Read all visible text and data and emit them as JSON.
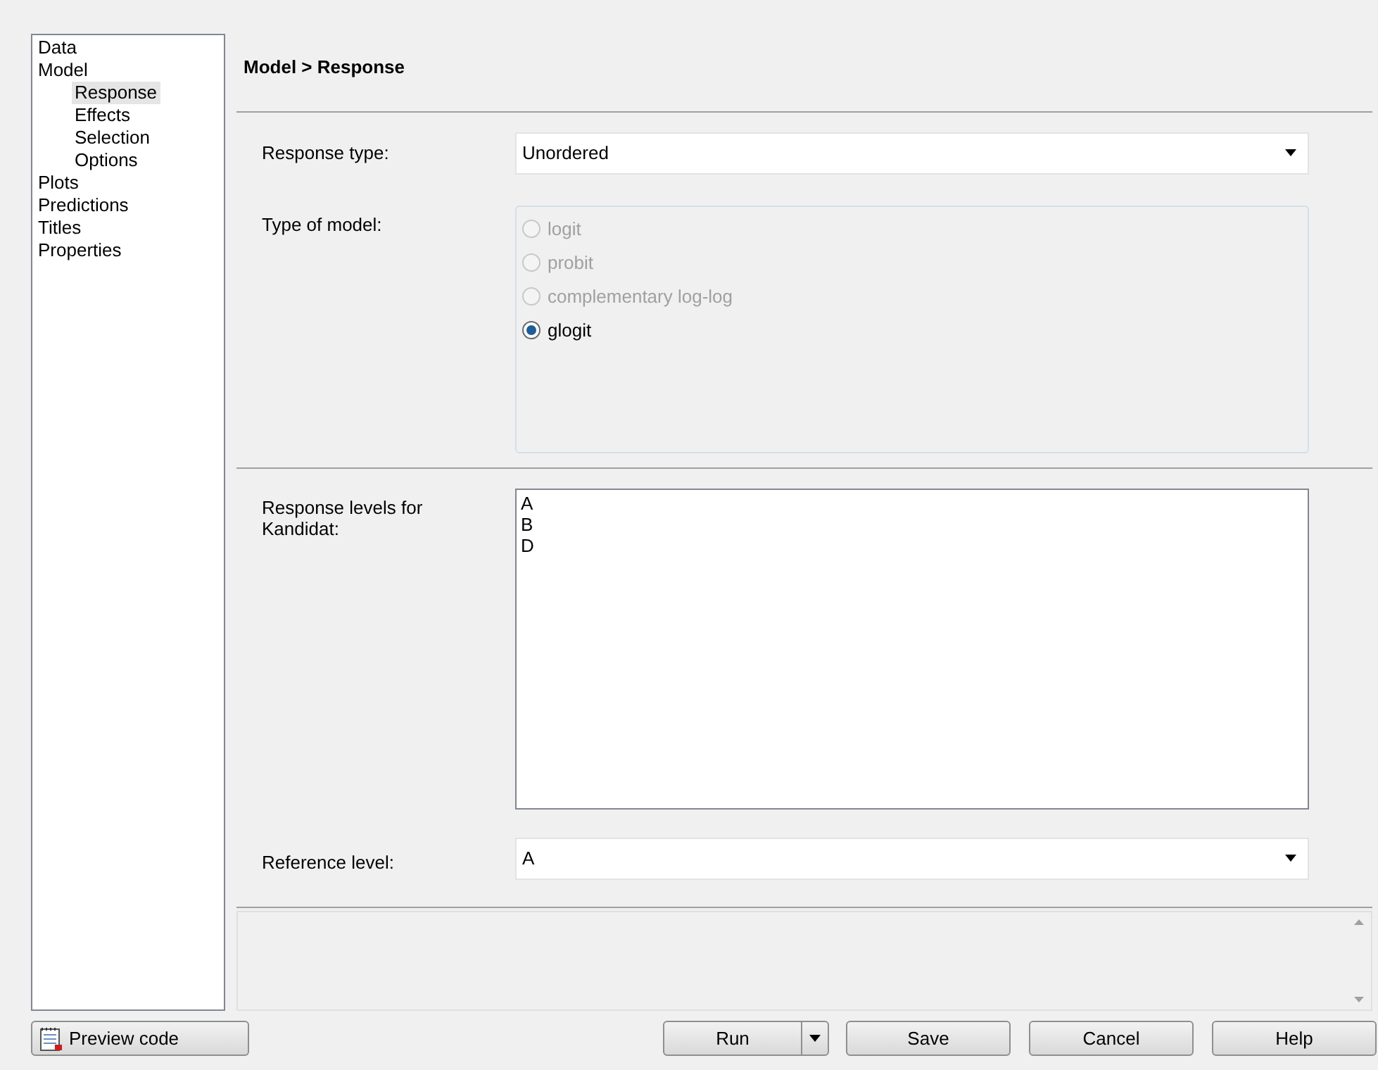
{
  "sidebar": {
    "items": [
      {
        "label": "Data",
        "selected": false
      },
      {
        "label": "Model",
        "selected": false,
        "children": [
          {
            "label": "Response",
            "selected": true
          },
          {
            "label": "Effects",
            "selected": false
          },
          {
            "label": "Selection",
            "selected": false
          },
          {
            "label": "Options",
            "selected": false
          }
        ]
      },
      {
        "label": "Plots",
        "selected": false
      },
      {
        "label": "Predictions",
        "selected": false
      },
      {
        "label": "Titles",
        "selected": false
      },
      {
        "label": "Properties",
        "selected": false
      }
    ]
  },
  "header": "Model > Response",
  "response_type": {
    "label": "Response type:",
    "value": "Unordered"
  },
  "model_type": {
    "label": "Type of model:",
    "options": [
      {
        "label": "logit",
        "selected": false,
        "disabled": true
      },
      {
        "label": "probit",
        "selected": false,
        "disabled": true
      },
      {
        "label": "complementary log-log",
        "selected": false,
        "disabled": true
      },
      {
        "label": "glogit",
        "selected": true,
        "disabled": false
      }
    ]
  },
  "response_levels": {
    "label": "Response levels for Kandidat:",
    "items": [
      "A",
      "B",
      "D"
    ]
  },
  "reference_level": {
    "label": "Reference level:",
    "value": "A"
  },
  "buttons": {
    "preview": "Preview code",
    "run": "Run",
    "save": "Save",
    "cancel": "Cancel",
    "help": "Help"
  }
}
